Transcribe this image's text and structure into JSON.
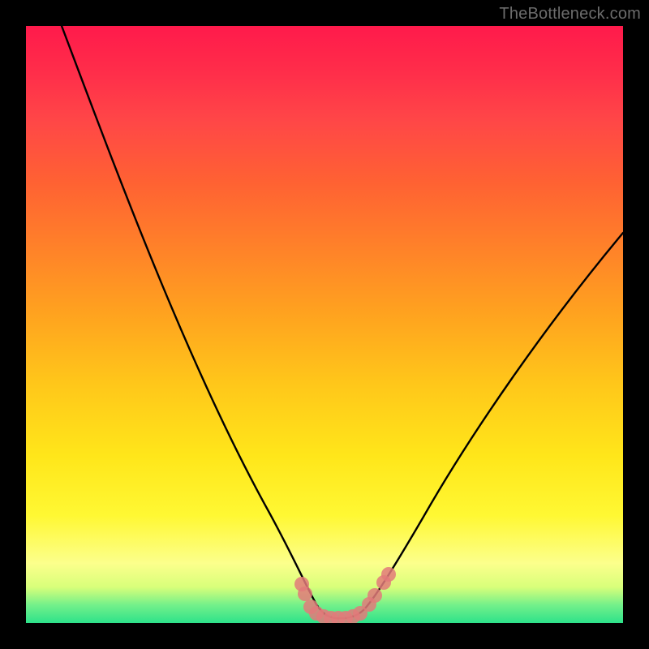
{
  "watermark": "TheBottleneck.com",
  "chart_data": {
    "type": "line",
    "title": "",
    "xlabel": "",
    "ylabel": "",
    "xlim": [
      0,
      100
    ],
    "ylim": [
      0,
      100
    ],
    "series": [
      {
        "name": "bottleneck-curve",
        "x": [
          6,
          10,
          15,
          20,
          25,
          30,
          35,
          40,
          43,
          45,
          47,
          49,
          51,
          53,
          55,
          57,
          60,
          64,
          70,
          78,
          88,
          100
        ],
        "y": [
          100,
          90,
          78,
          66,
          54,
          42,
          30,
          18,
          10,
          6,
          3,
          1,
          0.5,
          0.5,
          1,
          3,
          6,
          10,
          18,
          30,
          45,
          62
        ]
      }
    ],
    "markers": {
      "name": "highlight-points",
      "x": [
        45,
        47,
        48,
        49,
        50,
        51,
        52,
        53,
        54,
        55,
        56,
        58,
        60
      ],
      "y": [
        6,
        3,
        1.5,
        1,
        0.7,
        0.5,
        0.5,
        0.7,
        1,
        1.5,
        3,
        6,
        9
      ]
    },
    "gradient_bands": [
      {
        "pos": 0.0,
        "color": "#ff1a4b"
      },
      {
        "pos": 0.5,
        "color": "#ffc71a"
      },
      {
        "pos": 0.9,
        "color": "#fcff8c"
      },
      {
        "pos": 1.0,
        "color": "#2de28a"
      }
    ]
  }
}
